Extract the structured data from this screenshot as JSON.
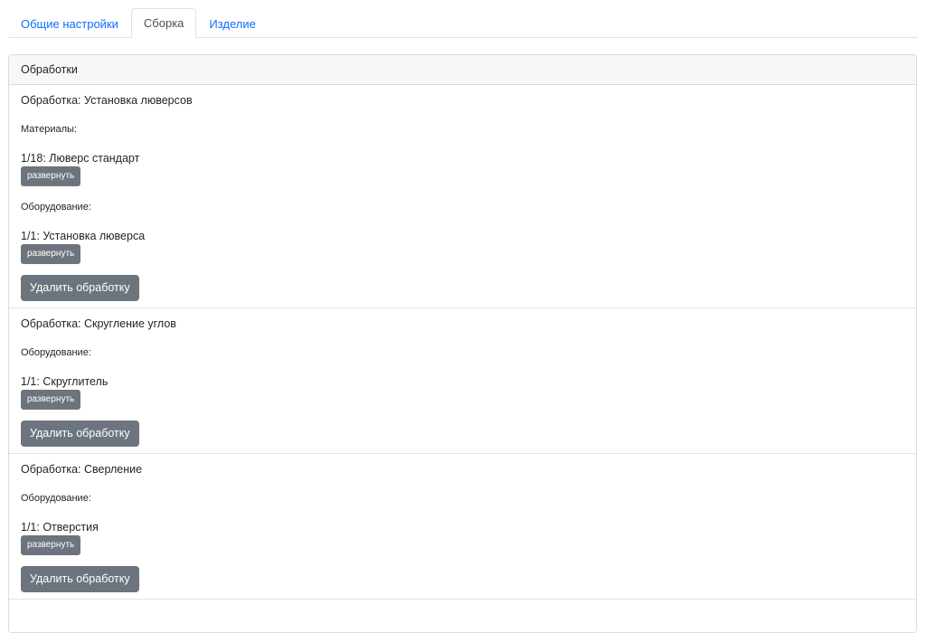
{
  "tabs": [
    {
      "label": "Общие настройки",
      "active": false
    },
    {
      "label": "Сборка",
      "active": true
    },
    {
      "label": "Изделие",
      "active": false
    }
  ],
  "card": {
    "header": "Обработки"
  },
  "operations": [
    {
      "title": "Обработка: Установка люверсов",
      "sections": [
        {
          "label": "Материалы:",
          "items": [
            {
              "text": "1/18: Люверс стандарт",
              "button": "развернуть"
            }
          ]
        },
        {
          "label": "Оборудование:",
          "items": [
            {
              "text": "1/1: Установка люверса",
              "button": "развернуть"
            }
          ]
        }
      ],
      "delete_label": "Удалить обработку"
    },
    {
      "title": "Обработка: Скругление углов",
      "sections": [
        {
          "label": "Оборудование:",
          "items": [
            {
              "text": "1/1: Скруглитель",
              "button": "развернуть"
            }
          ]
        }
      ],
      "delete_label": "Удалить обработку"
    },
    {
      "title": "Обработка: Сверление",
      "sections": [
        {
          "label": "Оборудование:",
          "items": [
            {
              "text": "1/1: Отверстия",
              "button": "развернуть"
            }
          ]
        }
      ],
      "delete_label": "Удалить обработку"
    }
  ]
}
